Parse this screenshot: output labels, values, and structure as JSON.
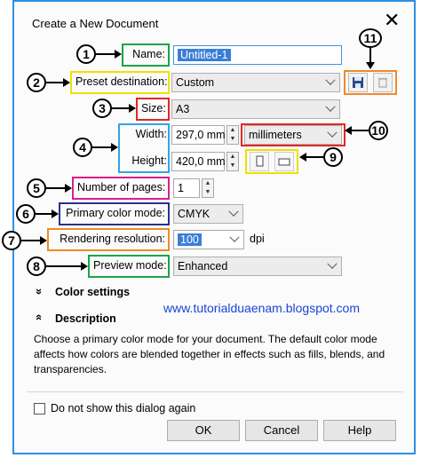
{
  "dialog": {
    "title": "Create a New Document",
    "close_glyph": "✕"
  },
  "fields": {
    "name_label": "Name:",
    "name_value": "Untitled-1",
    "preset_label": "Preset destination:",
    "preset_value": "Custom",
    "size_label": "Size:",
    "size_value": "A3",
    "width_label": "Width:",
    "width_value": "297,0 mm",
    "units_value": "millimeters",
    "height_label": "Height:",
    "height_value": "420,0 mm",
    "pages_label": "Number of pages:",
    "pages_value": "1",
    "color_mode_label": "Primary color mode:",
    "color_mode_value": "CMYK",
    "resolution_label": "Rendering resolution:",
    "resolution_value": "100",
    "resolution_unit": "dpi",
    "preview_label": "Preview mode:",
    "preview_value": "Enhanced"
  },
  "sections": {
    "color_settings": "Color settings",
    "color_settings_glyph": "»",
    "description": "Description",
    "description_glyph": "«",
    "description_text": "Choose a primary color mode for your document. The default color mode affects how colors are blended together in effects such as fills, blends, and transparencies."
  },
  "footer": {
    "checkbox_label": "Do not show this dialog again",
    "checkbox_checked": false,
    "ok": "OK",
    "cancel": "Cancel",
    "help": "Help"
  },
  "watermark": "www.tutorialduaenam.blogspot.com",
  "callouts": [
    "1",
    "2",
    "3",
    "4",
    "5",
    "6",
    "7",
    "8",
    "9",
    "10",
    "11"
  ],
  "icons": {
    "save_preset": "save-icon",
    "delete_preset": "trash-icon",
    "portrait": "portrait-icon",
    "landscape": "landscape-icon"
  },
  "colors": {
    "frame": "#2e90e6",
    "name_box": "#1aa34a",
    "preset_box": "#f0e000",
    "size_box": "#e32626",
    "dimensions_box": "#2ea6e8",
    "pages_box": "#d8208c",
    "color_mode_box": "#2a2f8f",
    "resolution_box": "#f08a28",
    "watermark": "#1a44d8"
  }
}
